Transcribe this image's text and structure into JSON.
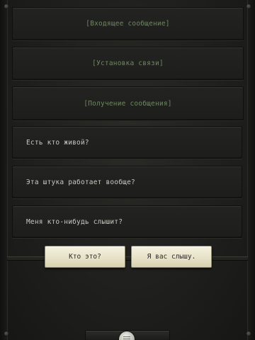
{
  "log": {
    "system_messages": [
      "[Входящее сообщение]",
      "[Установка связи]",
      "[Получение сообщения]"
    ],
    "player_messages": [
      "Есть кто живой?",
      "Эта штука работает вообще?",
      "Меня кто-нибудь слышит?"
    ]
  },
  "choices": [
    "Кто это?",
    "Я вас слышу."
  ],
  "menu": {
    "icon": "menu-knob-icon"
  },
  "colors": {
    "system_text": "#6d8a5f",
    "player_text": "#c9c9c2",
    "button_face": "#ece7cc",
    "background": "#1f1f1d"
  }
}
